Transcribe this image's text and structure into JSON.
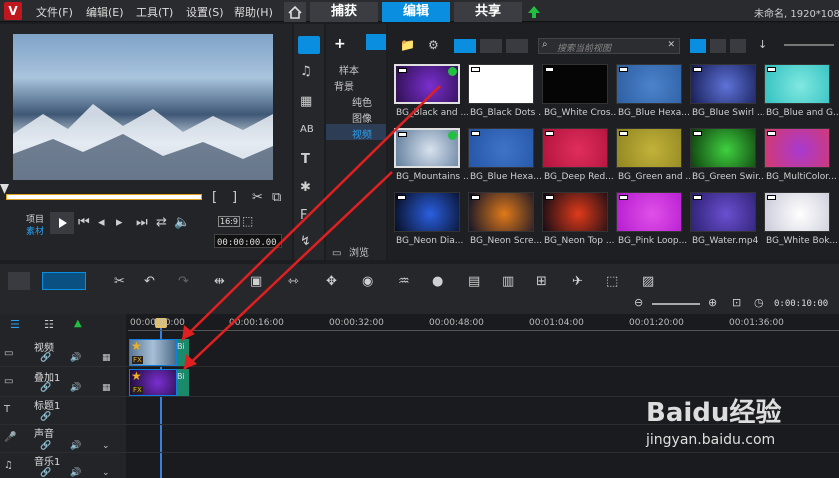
{
  "menu": [
    "文件(F)",
    "编辑(E)",
    "工具(T)",
    "设置(S)",
    "帮助(H)"
  ],
  "tabs": {
    "capture": "捕获",
    "edit": "编辑",
    "share": "共享"
  },
  "project_info": "未命名, 1920*108",
  "tree": {
    "sample": "样本",
    "background": "背景",
    "solid": "纯色",
    "image": "图像",
    "video": "视频"
  },
  "browse_label": "浏览",
  "search_placeholder": "搜索当前视图",
  "player": {
    "project_label": "项目",
    "clip_label": "素材",
    "aspect": "16:9",
    "timecode": "00:00:00.00"
  },
  "timeline": {
    "end_time": "0:00:10:00",
    "ruler": [
      "00:00:00:00",
      "00:00:16:00",
      "00:00:32:00",
      "00:00:48:00",
      "00:01:04:00",
      "00:01:20:00",
      "00:01:36:00"
    ],
    "tracks": [
      "视频",
      "叠加1",
      "标题1",
      "声音",
      "音乐1"
    ],
    "clip_tag": "Bi"
  },
  "watermark": {
    "brand": "Baidu经验",
    "url": "jingyan.baidu.com"
  },
  "library": [
    {
      "label": "BG_Black and ...",
      "color": "#2b0f4a",
      "accent": "#7a2fd0",
      "checked": true,
      "selected": true
    },
    {
      "label": "BG_Black Dots ...",
      "color": "#ffffff",
      "accent": "#ffffff",
      "checked": false,
      "selected": false
    },
    {
      "label": "BG_White Cros...",
      "color": "#050505",
      "accent": "#050505",
      "checked": false,
      "selected": false
    },
    {
      "label": "BG_Blue Hexa...",
      "color": "#2d5da0",
      "accent": "#4b83cc",
      "checked": false,
      "selected": false
    },
    {
      "label": "BG_Blue Swirl ...",
      "color": "#141a50",
      "accent": "#5e73d8",
      "checked": false,
      "selected": false
    },
    {
      "label": "BG_Blue and G...",
      "color": "#2fbfc0",
      "accent": "#80e8e0",
      "checked": false,
      "selected": false
    },
    {
      "label": "BG_Mountains ...",
      "color": "#5b7899",
      "accent": "#d8e2ee",
      "checked": true,
      "selected": true
    },
    {
      "label": "BG_Blue Hexa...",
      "color": "#2454a6",
      "accent": "#3e74c6",
      "checked": false,
      "selected": false
    },
    {
      "label": "BG_Deep Red...",
      "color": "#b0123c",
      "accent": "#e02e5c",
      "checked": false,
      "selected": false
    },
    {
      "label": "BG_Green and ...",
      "color": "#8f8420",
      "accent": "#c2b23a",
      "checked": false,
      "selected": false
    },
    {
      "label": "BG_Green Swir...",
      "color": "#0c3a0c",
      "accent": "#3fd03f",
      "checked": false,
      "selected": false
    },
    {
      "label": "BG_MultiColor...",
      "color": "#d63a6a",
      "accent": "#a83ad0",
      "checked": false,
      "selected": false
    },
    {
      "label": "BG_Neon Dia...",
      "color": "#060a1a",
      "accent": "#2a5fe0",
      "checked": false,
      "selected": false
    },
    {
      "label": "BG_Neon Scre...",
      "color": "#0a0f2a",
      "accent": "#e07a1a",
      "checked": false,
      "selected": false
    },
    {
      "label": "BG_Neon Top ...",
      "color": "#0a0a14",
      "accent": "#e03a1a",
      "checked": false,
      "selected": false
    },
    {
      "label": "BG_Pink Loop...",
      "color": "#b41ad0",
      "accent": "#e050e8",
      "checked": false,
      "selected": false
    },
    {
      "label": "BG_Water.mp4",
      "color": "#2a1f6e",
      "accent": "#6a4fd0",
      "checked": false,
      "selected": false
    },
    {
      "label": "BG_White Bok...",
      "color": "#c8c8d8",
      "accent": "#ffffff",
      "checked": false,
      "selected": false
    }
  ],
  "colors": {
    "accent": "#0a8fe0",
    "arrow": "#e02020",
    "timeline_bg": "#1a1b1e"
  }
}
